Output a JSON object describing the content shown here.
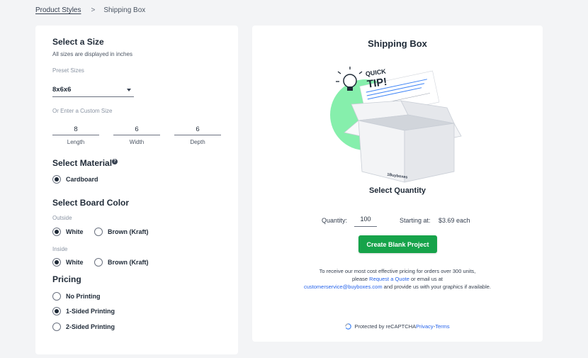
{
  "breadcrumb": {
    "link": "Product Styles",
    "separator": ">",
    "current": "Shipping Box"
  },
  "size": {
    "heading": "Select a Size",
    "subtitle": "All sizes are displayed in inches",
    "preset_label": "Preset Sizes",
    "preset_value": "8x6x6",
    "custom_label": "Or Enter a Custom Size",
    "length": {
      "value": "8",
      "label": "Length"
    },
    "width": {
      "value": "6",
      "label": "Width"
    },
    "depth": {
      "value": "6",
      "label": "Depth"
    }
  },
  "material": {
    "heading": "Select Material",
    "help_glyph": "?",
    "option": "Cardboard"
  },
  "board_color": {
    "heading": "Select Board Color",
    "outside_label": "Outside",
    "inside_label": "Inside",
    "white": "White",
    "brown": "Brown (Kraft)"
  },
  "pricing": {
    "heading": "Pricing",
    "options": [
      "No Printing",
      "1-Sided Printing",
      "2-Sided Printing"
    ],
    "selected": "1-Sided Printing"
  },
  "product": {
    "title": "Shipping Box",
    "quick_tip_1": "QUICK",
    "quick_tip_2": "TIP!",
    "box_brand": "1Buyboxes"
  },
  "quantity": {
    "heading": "Select Quantity",
    "label": "Quantity:",
    "value": "100",
    "starting_label": "Starting at:",
    "starting_value": "$3.69 each"
  },
  "cta": {
    "label": "Create Blank Project"
  },
  "info": {
    "line1": "To receive our most cost effective pricing for orders over 300 units,",
    "please": "please ",
    "quote_link": "Request a Quote",
    "or_email": " or email us at",
    "email": "customerservice@buyboxes.com",
    "tail": " and provide us with your graphics if available."
  },
  "recaptcha": {
    "text": "Protected by reCAPTCHA ",
    "privacy": "Privacy",
    "dash": " - ",
    "terms": "Terms"
  },
  "colors": {
    "accent_green": "#16a34a",
    "link_blue": "#2563eb",
    "background": "#f3f4f6"
  }
}
